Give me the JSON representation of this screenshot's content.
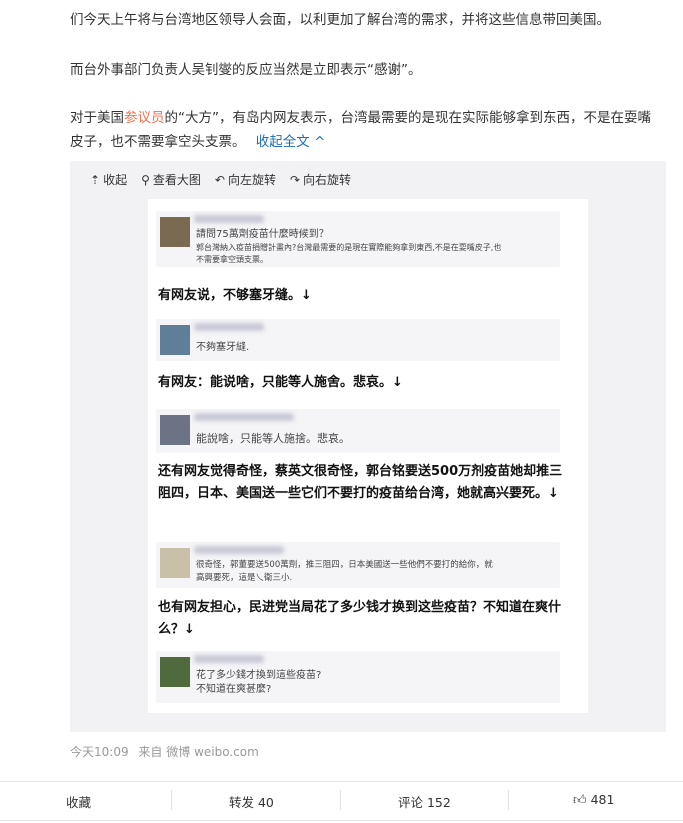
{
  "paragraphs": {
    "p1": "们今天上午将与台湾地区领导人会面，以利更加了解台湾的需求，并将这些信息带回美国。",
    "p2": "而台外事部门负责人吴钊燮的反应当然是立即表示“感谢”。",
    "p3_pre": "对于美国",
    "p3_link": "参议员",
    "p3_post": "的“大方”，有岛内网友表示，台湾最需要的是现在实际能够拿到东西，不是在耍嘴皮子，也不需要拿空头支票。",
    "collapse": "收起全文"
  },
  "toolbar": {
    "collapse": "收起",
    "view_large": "查看大图",
    "rotate_left": "向左旋转",
    "rotate_right": "向右旋转"
  },
  "image": {
    "posts": [
      {
        "line1": "請問75萬劑疫苗什麼時候到？",
        "line2": "郭台灣納入疫苗捐贈計畫內?台灣最需要的是現在實際能夠拿到東西,不是在耍嘴皮子,也",
        "line3": "不需要拿空頭支票。"
      },
      {
        "line1": "不夠塞牙縫."
      },
      {
        "line1": "能說啥，只能等人施捨。悲哀。"
      },
      {
        "line1": "很奇怪，郭董要送500萬劑，推三阻四，日本美國送一些他們不要打的給你，就",
        "line2": "高興要死，這是乀衛三小."
      },
      {
        "line1": "花了多少錢才換到這些疫苗?",
        "line2": "不知道在爽甚麼?"
      }
    ],
    "captions": [
      "有网友说，不够塞牙缝。↓",
      "有网友：能说啥，只能等人施舍。悲哀。↓",
      "还有网友觉得奇怪，蔡英文很奇怪，郭台铭要送500万剂疫苗她却推三阻四，日本、美国送一些它们不要打的疫苗给台湾，她就高兴要死。↓",
      "也有网友担心，民进党当局花了多少钱才换到这些疫苗？不知道在爽什么？↓"
    ]
  },
  "meta": {
    "time": "今天10:09",
    "from": "来自",
    "source": "微博 weibo.com"
  },
  "actions": {
    "favorite": "收藏",
    "repost": "转发 40",
    "comment": "评论 152",
    "like": "481"
  }
}
